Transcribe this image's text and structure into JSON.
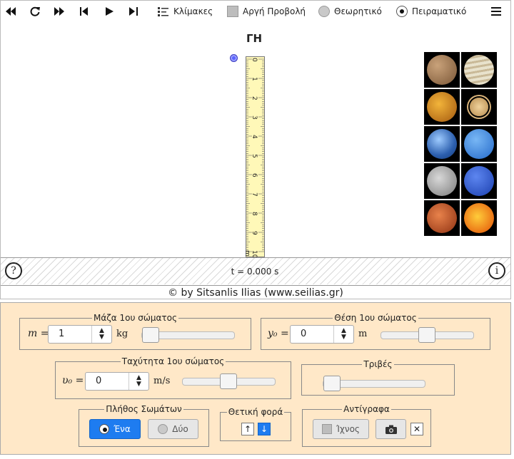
{
  "toolbar": {
    "scales_label": "Κλίμακες",
    "slow_motion_label": "Αργή Προβολή",
    "theoretical_label": "Θεωρητικό",
    "experimental_label": "Πειραματικό"
  },
  "sim": {
    "planet_title": "ΓΗ",
    "ruler_ticks": [
      "0",
      "1",
      "2",
      "3",
      "4",
      "5",
      "6",
      "7",
      "8",
      "9",
      "10 m"
    ],
    "time_text": "t = 0.000 s",
    "help_glyph": "?",
    "info_glyph": "i",
    "planets": [
      "mercury",
      "jupiter",
      "venus",
      "saturn",
      "earth",
      "neptune",
      "moon",
      "uranus",
      "mars",
      "sun"
    ]
  },
  "copyright": "© by Sitsanlis Ilias (www.seilias.gr)",
  "controls": {
    "mass": {
      "legend": "Μάζα 1ου σώματος",
      "symbol": "m =",
      "value": "1",
      "unit": "kg",
      "slider_fraction": 0.1
    },
    "position": {
      "legend": "Θέση 1ου σώματος",
      "symbol": "y₀ =",
      "value": "0",
      "unit": "m",
      "slider_fraction": 0.5
    },
    "velocity": {
      "legend": "Ταχύτητα 1ου σώματος",
      "symbol": "υ₀ =",
      "value": "0",
      "unit": "m/s",
      "slider_fraction": 0.5
    },
    "friction": {
      "legend": "Τριβές",
      "slider_fraction": 0.0
    },
    "bodies": {
      "legend": "Πλήθος Σωμάτων",
      "one_label": "Ένα",
      "two_label": "Δύο"
    },
    "direction": {
      "legend": "Θετική φορά",
      "up": "↑",
      "down": "↓"
    },
    "copy": {
      "legend": "Αντίγραφα",
      "trace_label": "Ίχνος",
      "close": "✕"
    }
  }
}
